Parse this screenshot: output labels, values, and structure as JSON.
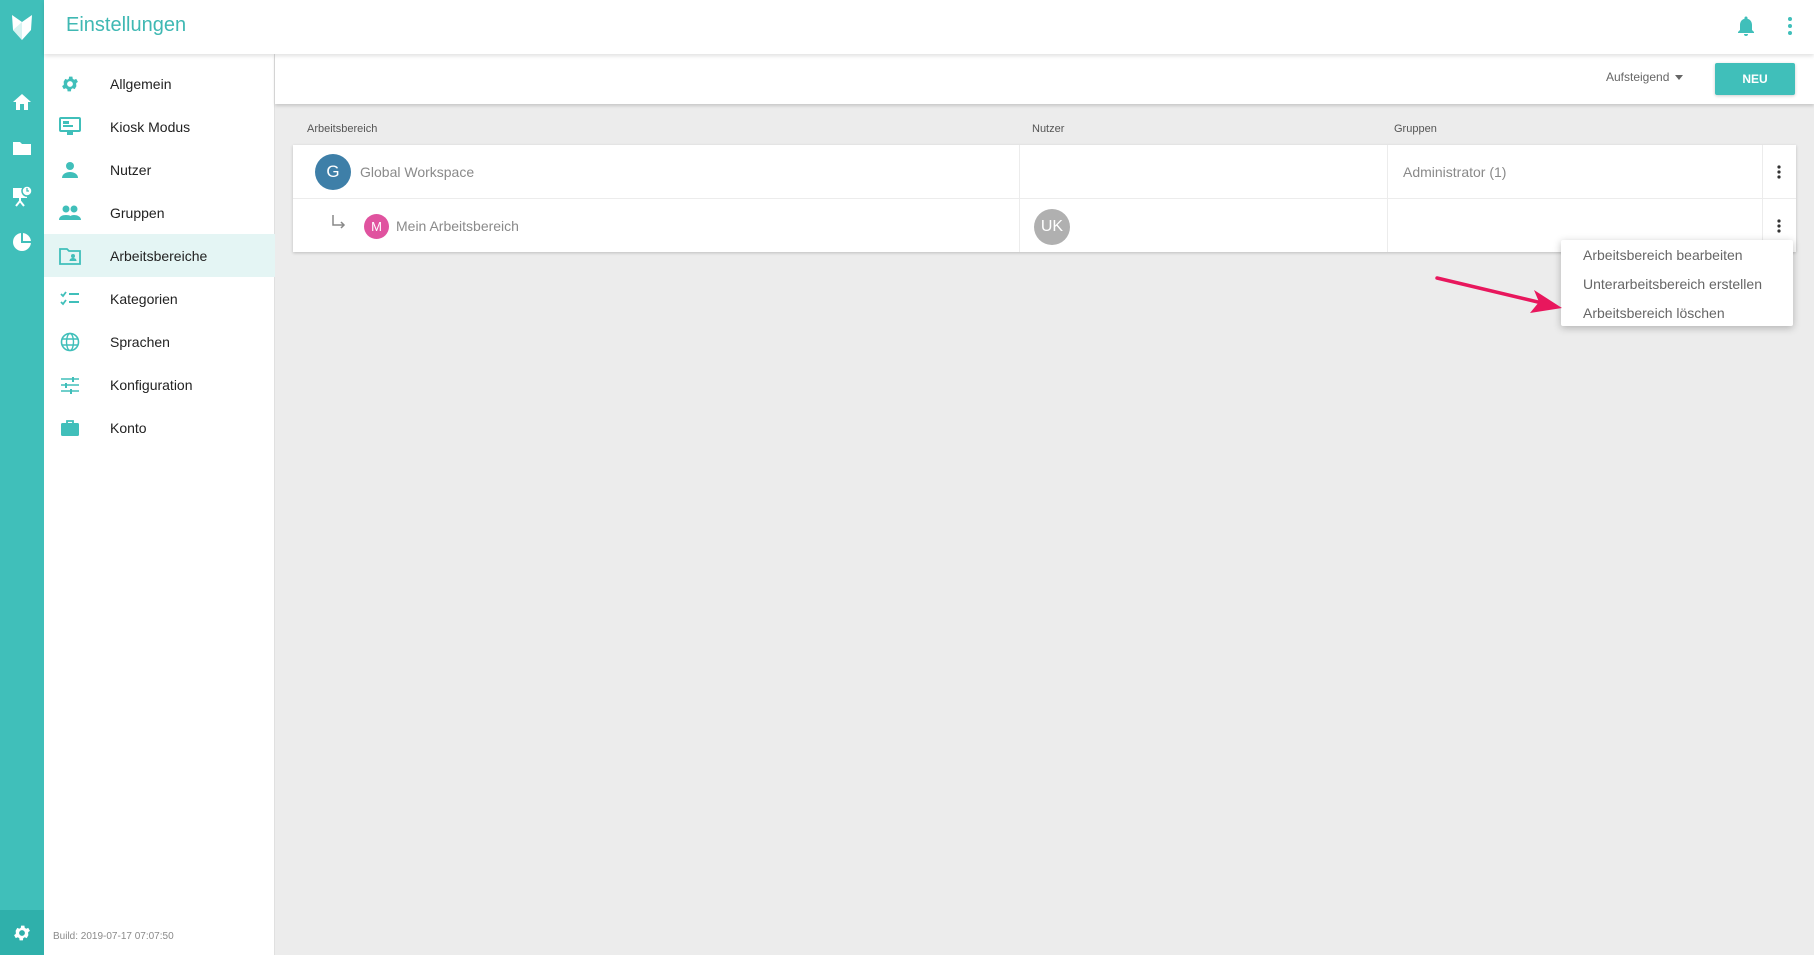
{
  "header": {
    "title": "Einstellungen"
  },
  "rail": {
    "icons": [
      "logo-icon",
      "home-icon",
      "folder-icon",
      "presentation-icon",
      "pie-chart-icon",
      "gear-icon"
    ]
  },
  "sidebar": {
    "items": [
      {
        "label": "Allgemein",
        "icon": "gear-icon"
      },
      {
        "label": "Kiosk Modus",
        "icon": "monitor-icon"
      },
      {
        "label": "Nutzer",
        "icon": "person-icon"
      },
      {
        "label": "Gruppen",
        "icon": "people-icon"
      },
      {
        "label": "Arbeitsbereiche",
        "icon": "workspace-icon"
      },
      {
        "label": "Kategorien",
        "icon": "checklist-icon"
      },
      {
        "label": "Sprachen",
        "icon": "globe-icon"
      },
      {
        "label": "Konfiguration",
        "icon": "sliders-icon"
      },
      {
        "label": "Konto",
        "icon": "briefcase-icon"
      }
    ],
    "active": "Arbeitsbereiche",
    "build": "Build: 2019-07-17 07:07:50"
  },
  "toolbar": {
    "sort_label": "Aufsteigend",
    "new_button": "NEU"
  },
  "table": {
    "headers": {
      "workspace": "Arbeitsbereich",
      "users": "Nutzer",
      "groups": "Gruppen"
    },
    "rows": [
      {
        "avatar_letter": "G",
        "avatar_color": "#3e7fa8",
        "name": "Global Workspace",
        "user_avatar": "",
        "groups": "Administrator (1)"
      },
      {
        "avatar_letter": "M",
        "avatar_color": "#e0539f",
        "name": "Mein Arbeitsbereich",
        "user_avatar": "UK",
        "groups": ""
      }
    ]
  },
  "menu": {
    "items": [
      "Arbeitsbereich bearbeiten",
      "Unterarbeitsbereich erstellen",
      "Arbeitsbereich löschen"
    ]
  },
  "colors": {
    "accent": "#40bfba",
    "arrow": "#e8175d"
  }
}
